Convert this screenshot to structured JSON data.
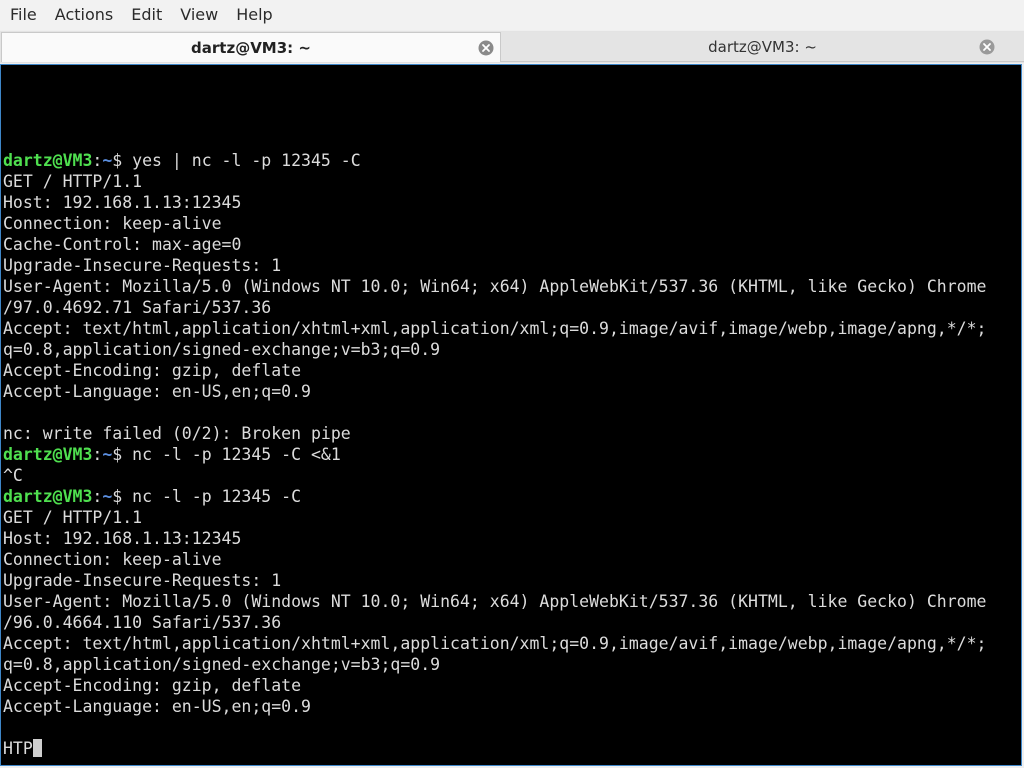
{
  "menubar": {
    "items": [
      "File",
      "Actions",
      "Edit",
      "View",
      "Help"
    ]
  },
  "tabs": [
    {
      "label": "dartz@VM3: ~",
      "active": true
    },
    {
      "label": "dartz@VM3: ~",
      "active": false
    }
  ],
  "terminal": {
    "prompt_user": "dartz@VM3",
    "prompt_colon": ":",
    "prompt_path": "~",
    "prompt_symbol": "$ ",
    "lines": [
      {
        "type": "cmd",
        "text": "yes | nc -l -p 12345 -C"
      },
      {
        "type": "out",
        "text": "GET / HTTP/1.1"
      },
      {
        "type": "out",
        "text": "Host: 192.168.1.13:12345"
      },
      {
        "type": "out",
        "text": "Connection: keep-alive"
      },
      {
        "type": "out",
        "text": "Cache-Control: max-age=0"
      },
      {
        "type": "out",
        "text": "Upgrade-Insecure-Requests: 1"
      },
      {
        "type": "out",
        "text": "User-Agent: Mozilla/5.0 (Windows NT 10.0; Win64; x64) AppleWebKit/537.36 (KHTML, like Gecko) Chrome"
      },
      {
        "type": "out",
        "text": "/97.0.4692.71 Safari/537.36"
      },
      {
        "type": "out",
        "text": "Accept: text/html,application/xhtml+xml,application/xml;q=0.9,image/avif,image/webp,image/apng,*/*;"
      },
      {
        "type": "out",
        "text": "q=0.8,application/signed-exchange;v=b3;q=0.9"
      },
      {
        "type": "out",
        "text": "Accept-Encoding: gzip, deflate"
      },
      {
        "type": "out",
        "text": "Accept-Language: en-US,en;q=0.9"
      },
      {
        "type": "out",
        "text": ""
      },
      {
        "type": "out",
        "text": "nc: write failed (0/2): Broken pipe"
      },
      {
        "type": "cmd",
        "text": "nc -l -p 12345 -C <&1"
      },
      {
        "type": "out",
        "text": "^C"
      },
      {
        "type": "cmd",
        "text": "nc -l -p 12345 -C"
      },
      {
        "type": "out",
        "text": "GET / HTTP/1.1"
      },
      {
        "type": "out",
        "text": "Host: 192.168.1.13:12345"
      },
      {
        "type": "out",
        "text": "Connection: keep-alive"
      },
      {
        "type": "out",
        "text": "Upgrade-Insecure-Requests: 1"
      },
      {
        "type": "out",
        "text": "User-Agent: Mozilla/5.0 (Windows NT 10.0; Win64; x64) AppleWebKit/537.36 (KHTML, like Gecko) Chrome"
      },
      {
        "type": "out",
        "text": "/96.0.4664.110 Safari/537.36"
      },
      {
        "type": "out",
        "text": "Accept: text/html,application/xhtml+xml,application/xml;q=0.9,image/avif,image/webp,image/apng,*/*;"
      },
      {
        "type": "out",
        "text": "q=0.8,application/signed-exchange;v=b3;q=0.9"
      },
      {
        "type": "out",
        "text": "Accept-Encoding: gzip, deflate"
      },
      {
        "type": "out",
        "text": "Accept-Language: en-US,en;q=0.9"
      },
      {
        "type": "out",
        "text": ""
      },
      {
        "type": "input",
        "text": "HTP"
      }
    ]
  },
  "colors": {
    "prompt_user": "#4fe04f",
    "prompt_path": "#5b8fe0",
    "terminal_bg": "#000000",
    "terminal_fg": "#dcdcdc",
    "focus_border": "#3e86c8"
  },
  "icons": {
    "tab_close": "close-circle-icon"
  }
}
